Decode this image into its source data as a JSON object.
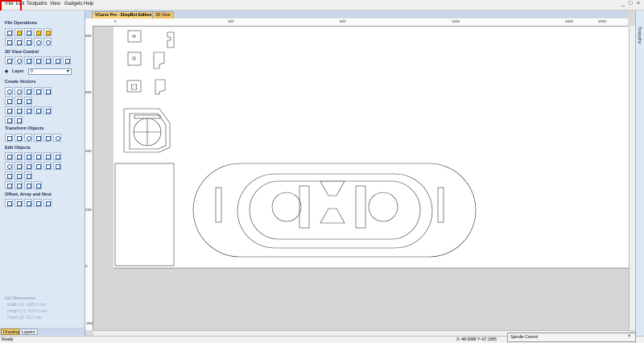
{
  "menubar": {
    "items": [
      "File",
      "Edit",
      "Toolpaths",
      "View",
      "Gadgets",
      "Help"
    ],
    "controls": {
      "min": "_",
      "max": "□",
      "close": "×"
    }
  },
  "tabs": {
    "active": "VCarve Pro - ShopBot Edition",
    "other": "3D View"
  },
  "sidebar": {
    "file_ops": "File Operations",
    "view_ctl": "2D View Control",
    "layer_label": "Layer",
    "layer_value": "0",
    "create_vectors": "Create Vectors",
    "transform": "Transform Objects",
    "edit": "Edit Objects",
    "offset": "Offset, Array and Nest"
  },
  "jobdims": {
    "title": "Job Dimensions",
    "width": "Width  [X]: 2435.0 mm",
    "height": "Height [Y]: 1215.0 mm",
    "depth": "Depth  [Z]: 15.0 mm"
  },
  "bottom_tabs": {
    "drawing": "Drawing",
    "layers": "Layers"
  },
  "ruler": {
    "top": [
      "0",
      "400",
      "800",
      "1200",
      "1600",
      "2000"
    ],
    "left": [
      "800",
      "600",
      "400",
      "200",
      "0",
      "-200"
    ]
  },
  "right_pane": {
    "label": "Toolpaths"
  },
  "status": {
    "left": "Ready",
    "coords": "X:-48.0088 Y:-67.1955"
  },
  "spindle": {
    "label": "Spindle Control"
  }
}
